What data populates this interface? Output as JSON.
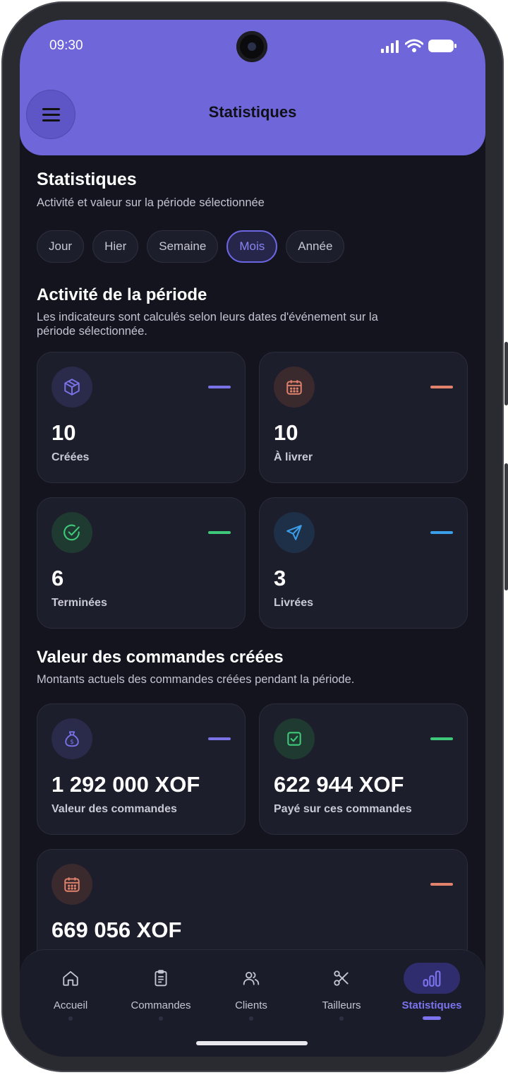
{
  "status_bar": {
    "time": "09:30"
  },
  "header": {
    "title": "Statistiques",
    "menu_icon": "hamburger-icon"
  },
  "page": {
    "title": "Statistiques",
    "subtitle": "Activité et valeur sur la période sélectionnée"
  },
  "period_filter": {
    "options": [
      "Jour",
      "Hier",
      "Semaine",
      "Mois",
      "Année"
    ],
    "selected": "Mois"
  },
  "activity": {
    "title": "Activité de la période",
    "description_line1": "Les indicateurs sont calculés selon leurs dates d'événement sur la",
    "description_line2": "période sélectionnée.",
    "cards": [
      {
        "value": "10",
        "label": "Créées",
        "icon": "box-icon",
        "accent": "#7a73e8",
        "icon_bg": "#2a2a4a"
      },
      {
        "value": "10",
        "label": "À livrer",
        "icon": "calendar-icon",
        "accent": "#e0826c",
        "icon_bg": "#3a2a2e"
      },
      {
        "value": "6",
        "label": "Terminées",
        "icon": "check-circle-icon",
        "accent": "#3ec97a",
        "icon_bg": "#1f3a30"
      },
      {
        "value": "3",
        "label": "Livrées",
        "icon": "send-icon",
        "accent": "#3b9ee8",
        "icon_bg": "#1e2f48"
      }
    ]
  },
  "order_value": {
    "title": "Valeur des commandes créées",
    "description": "Montants actuels des commandes créées pendant la période.",
    "cards": [
      {
        "value": "1 292 000 XOF",
        "label": "Valeur des commandes",
        "icon": "money-bag-icon",
        "accent": "#7a73e8",
        "icon_bg": "#2a2a4a"
      },
      {
        "value": "622 944 XOF",
        "label": "Payé sur ces commandes",
        "icon": "checkbox-icon",
        "accent": "#3ec97a",
        "icon_bg": "#1f3a30"
      },
      {
        "value": "669 056 XOF",
        "label": "",
        "icon": "calendar-icon",
        "accent": "#e0826c",
        "icon_bg": "#3a2a2e"
      }
    ]
  },
  "bottom_nav": {
    "items": [
      {
        "label": "Accueil",
        "icon": "home-icon"
      },
      {
        "label": "Commandes",
        "icon": "clipboard-icon"
      },
      {
        "label": "Clients",
        "icon": "users-icon"
      },
      {
        "label": "Tailleurs",
        "icon": "scissors-icon"
      },
      {
        "label": "Statistiques",
        "icon": "bar-chart-icon"
      }
    ],
    "active": "Statistiques"
  },
  "colors": {
    "header": "#6f66d9",
    "background": "#14141f",
    "card": "#1d1e2b",
    "accent": "#7b74ee"
  }
}
